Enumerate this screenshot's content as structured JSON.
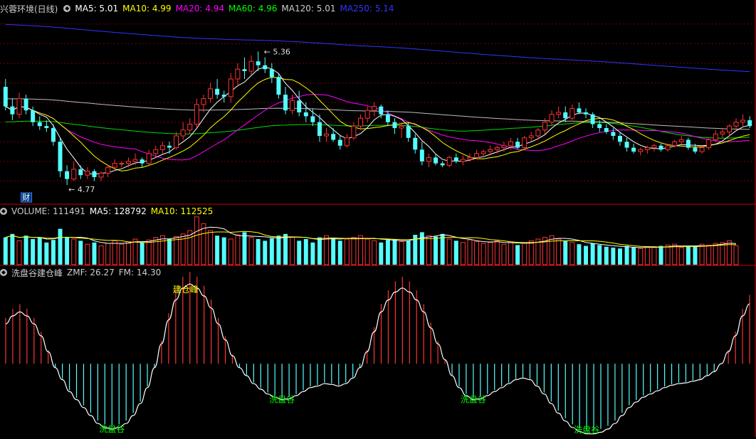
{
  "header": {
    "title": "兴蓉环境(日线)",
    "ma": [
      {
        "label": "MA5: 5.01",
        "color": "#ffffff"
      },
      {
        "label": "MA10: 4.99",
        "color": "#ffff00"
      },
      {
        "label": "MA20: 4.94",
        "color": "#ff00ff"
      },
      {
        "label": "MA60: 4.96",
        "color": "#00ff00"
      },
      {
        "label": "MA120: 5.01",
        "color": "#cccccc"
      },
      {
        "label": "MA250: 5.14",
        "color": "#3333ff"
      }
    ]
  },
  "volume_header": {
    "label": "VOLUME: 111491",
    "ma5": "MA5: 128792",
    "ma10": "MA10: 112525"
  },
  "indicator_header": {
    "name": "洗盘谷建仓峰",
    "zmf": "ZMF: 26.27",
    "fm": "FM: 14.30"
  },
  "colors": {
    "up": "#ff3333",
    "down": "#54ffff",
    "frame": "#cc0000",
    "bg": "#000000"
  },
  "chart_data": [
    {
      "type": "candlestick",
      "title": "兴蓉环境(日线)",
      "ylim": [
        4.6,
        5.55
      ],
      "annotations": [
        {
          "text": "5.36",
          "kind": "high"
        },
        {
          "text": "4.77",
          "kind": "low"
        },
        {
          "text": "财",
          "kind": "event"
        }
      ],
      "ohlc": [
        [
          5.18,
          5.22,
          5.06,
          5.08
        ],
        [
          5.08,
          5.12,
          5.01,
          5.04
        ],
        [
          5.04,
          5.15,
          5.02,
          5.12
        ],
        [
          5.12,
          5.14,
          5.04,
          5.06
        ],
        [
          5.06,
          5.08,
          4.98,
          5.0
        ],
        [
          5.0,
          5.03,
          4.96,
          4.98
        ],
        [
          4.98,
          5.01,
          4.95,
          4.97
        ],
        [
          4.97,
          4.99,
          4.88,
          4.9
        ],
        [
          4.9,
          4.92,
          4.72,
          4.75
        ],
        [
          4.75,
          4.78,
          4.68,
          4.71
        ],
        [
          4.71,
          4.8,
          4.7,
          4.76
        ],
        [
          4.76,
          4.78,
          4.71,
          4.73
        ],
        [
          4.73,
          4.77,
          4.71,
          4.75
        ],
        [
          4.75,
          4.76,
          4.7,
          4.72
        ],
        [
          4.72,
          4.75,
          4.7,
          4.74
        ],
        [
          4.74,
          4.78,
          4.72,
          4.77
        ],
        [
          4.77,
          4.81,
          4.75,
          4.79
        ],
        [
          4.79,
          4.8,
          4.77,
          4.79
        ],
        [
          4.79,
          4.82,
          4.77,
          4.8
        ],
        [
          4.8,
          4.84,
          4.78,
          4.81
        ],
        [
          4.81,
          4.82,
          4.77,
          4.79
        ],
        [
          4.79,
          4.86,
          4.78,
          4.84
        ],
        [
          4.84,
          4.88,
          4.82,
          4.86
        ],
        [
          4.86,
          4.9,
          4.84,
          4.88
        ],
        [
          4.88,
          4.9,
          4.84,
          4.87
        ],
        [
          4.87,
          4.95,
          4.86,
          4.93
        ],
        [
          4.93,
          5.0,
          4.91,
          4.96
        ],
        [
          4.96,
          5.02,
          4.94,
          4.99
        ],
        [
          4.99,
          5.12,
          4.97,
          5.09
        ],
        [
          5.09,
          5.14,
          5.05,
          5.12
        ],
        [
          5.12,
          5.2,
          5.1,
          5.17
        ],
        [
          5.17,
          5.22,
          5.12,
          5.14
        ],
        [
          5.14,
          5.16,
          5.1,
          5.13
        ],
        [
          5.13,
          5.25,
          5.1,
          5.22
        ],
        [
          5.22,
          5.3,
          5.18,
          5.27
        ],
        [
          5.27,
          5.33,
          5.22,
          5.26
        ],
        [
          5.26,
          5.34,
          5.24,
          5.31
        ],
        [
          5.31,
          5.36,
          5.26,
          5.29
        ],
        [
          5.29,
          5.33,
          5.25,
          5.27
        ],
        [
          5.27,
          5.3,
          5.2,
          5.23
        ],
        [
          5.23,
          5.25,
          5.12,
          5.14
        ],
        [
          5.14,
          5.18,
          5.04,
          5.06
        ],
        [
          5.06,
          5.14,
          5.04,
          5.11
        ],
        [
          5.11,
          5.16,
          5.03,
          5.05
        ],
        [
          5.05,
          5.1,
          5.0,
          5.03
        ],
        [
          5.03,
          5.07,
          4.98,
          5.0
        ],
        [
          5.0,
          5.04,
          4.9,
          4.93
        ],
        [
          4.93,
          4.97,
          4.9,
          4.94
        ],
        [
          4.94,
          4.97,
          4.9,
          4.91
        ],
        [
          4.91,
          4.93,
          4.86,
          4.88
        ],
        [
          4.88,
          4.94,
          4.87,
          4.92
        ],
        [
          4.92,
          5.0,
          4.91,
          4.98
        ],
        [
          4.98,
          5.04,
          4.96,
          5.02
        ],
        [
          5.02,
          5.08,
          5.0,
          5.06
        ],
        [
          5.06,
          5.1,
          5.03,
          5.08
        ],
        [
          5.08,
          5.09,
          5.02,
          5.04
        ],
        [
          5.04,
          5.06,
          4.98,
          5.0
        ],
        [
          5.0,
          5.02,
          4.94,
          4.97
        ],
        [
          4.97,
          5.0,
          4.92,
          4.98
        ],
        [
          4.98,
          5.0,
          4.9,
          4.92
        ],
        [
          4.92,
          4.94,
          4.84,
          4.86
        ],
        [
          4.86,
          4.9,
          4.78,
          4.8
        ],
        [
          4.8,
          4.84,
          4.77,
          4.82
        ],
        [
          4.82,
          4.84,
          4.78,
          4.79
        ],
        [
          4.79,
          4.8,
          4.77,
          4.78
        ],
        [
          4.78,
          4.83,
          4.77,
          4.82
        ],
        [
          4.82,
          4.84,
          4.79,
          4.8
        ],
        [
          4.8,
          4.83,
          4.78,
          4.81
        ],
        [
          4.81,
          4.84,
          4.8,
          4.82
        ],
        [
          4.82,
          4.86,
          4.81,
          4.84
        ],
        [
          4.84,
          4.86,
          4.82,
          4.85
        ],
        [
          4.85,
          4.88,
          4.83,
          4.86
        ],
        [
          4.86,
          4.88,
          4.84,
          4.87
        ],
        [
          4.87,
          4.9,
          4.85,
          4.88
        ],
        [
          4.88,
          4.92,
          4.86,
          4.9
        ],
        [
          4.9,
          4.92,
          4.86,
          4.87
        ],
        [
          4.87,
          4.93,
          4.86,
          4.92
        ],
        [
          4.92,
          4.95,
          4.9,
          4.93
        ],
        [
          4.93,
          4.97,
          4.91,
          4.96
        ],
        [
          4.96,
          5.02,
          4.94,
          5.0
        ],
        [
          5.0,
          5.06,
          4.98,
          5.04
        ],
        [
          5.04,
          5.08,
          5.02,
          5.05
        ],
        [
          5.05,
          5.08,
          5.0,
          5.02
        ],
        [
          5.02,
          5.09,
          5.01,
          5.07
        ],
        [
          5.07,
          5.1,
          5.04,
          5.05
        ],
        [
          5.05,
          5.07,
          5.02,
          5.04
        ],
        [
          5.04,
          5.05,
          4.97,
          4.99
        ],
        [
          4.99,
          5.01,
          4.95,
          4.97
        ],
        [
          4.97,
          4.99,
          4.94,
          4.95
        ],
        [
          4.95,
          4.97,
          4.91,
          4.93
        ],
        [
          4.93,
          4.95,
          4.88,
          4.9
        ],
        [
          4.9,
          4.92,
          4.85,
          4.87
        ],
        [
          4.87,
          4.89,
          4.84,
          4.85
        ],
        [
          4.85,
          4.87,
          4.83,
          4.86
        ],
        [
          4.86,
          4.88,
          4.84,
          4.87
        ],
        [
          4.87,
          4.89,
          4.85,
          4.88
        ],
        [
          4.88,
          4.89,
          4.85,
          4.86
        ],
        [
          4.86,
          4.89,
          4.85,
          4.88
        ],
        [
          4.88,
          4.91,
          4.87,
          4.9
        ],
        [
          4.9,
          4.93,
          4.89,
          4.91
        ],
        [
          4.91,
          4.92,
          4.86,
          4.87
        ],
        [
          4.87,
          4.89,
          4.84,
          4.85
        ],
        [
          4.85,
          4.88,
          4.84,
          4.87
        ],
        [
          4.87,
          4.92,
          4.86,
          4.91
        ],
        [
          4.91,
          4.96,
          4.9,
          4.94
        ],
        [
          4.94,
          4.97,
          4.92,
          4.95
        ],
        [
          4.95,
          4.99,
          4.93,
          4.98
        ],
        [
          4.98,
          5.02,
          4.96,
          5.0
        ],
        [
          5.0,
          5.04,
          4.98,
          5.01
        ],
        [
          5.01,
          5.03,
          4.97,
          4.98
        ]
      ]
    },
    {
      "type": "bar",
      "title": "VOLUME",
      "ylim": [
        0,
        300000
      ],
      "values": [
        160000,
        180000,
        140000,
        170000,
        150000,
        160000,
        130000,
        145000,
        210000,
        160000,
        150000,
        140000,
        120000,
        130000,
        110000,
        125000,
        140000,
        120000,
        135000,
        150000,
        130000,
        145000,
        160000,
        170000,
        150000,
        165000,
        180000,
        200000,
        280000,
        240000,
        200000,
        170000,
        160000,
        150000,
        175000,
        190000,
        160000,
        150000,
        140000,
        155000,
        170000,
        180000,
        160000,
        140000,
        150000,
        130000,
        160000,
        170000,
        150000,
        140000,
        150000,
        160000,
        170000,
        150000,
        140000,
        130000,
        145000,
        150000,
        135000,
        140000,
        175000,
        190000,
        170000,
        165000,
        180000,
        150000,
        140000,
        130000,
        145000,
        135000,
        125000,
        130000,
        140000,
        120000,
        130000,
        115000,
        125000,
        140000,
        150000,
        160000,
        170000,
        150000,
        140000,
        130000,
        120000,
        110000,
        125000,
        115000,
        105000,
        100000,
        95000,
        110000,
        100000,
        95000,
        105000,
        100000,
        110000,
        115000,
        120000,
        100000,
        105000,
        110000,
        120000,
        115000,
        125000,
        130000,
        140000,
        111491
      ],
      "series": [
        {
          "name": "MA5",
          "color": "#ffffff"
        },
        {
          "name": "MA10",
          "color": "#ffff00"
        }
      ]
    },
    {
      "type": "bar",
      "title": "洗盘谷建仓峰",
      "ylim": [
        -90,
        110
      ],
      "annotations": [
        {
          "text": "建仓峰"
        },
        {
          "text": "洗盘谷"
        },
        {
          "text": "洗盘谷"
        },
        {
          "text": "洗盘谷"
        },
        {
          "text": "洗盘谷"
        }
      ],
      "values": [
        50,
        60,
        65,
        60,
        50,
        35,
        15,
        -5,
        -20,
        -35,
        -45,
        -55,
        -65,
        -75,
        -80,
        -82,
        -80,
        -75,
        -65,
        -50,
        -30,
        -5,
        25,
        55,
        80,
        95,
        100,
        95,
        85,
        70,
        50,
        30,
        10,
        -5,
        -15,
        -25,
        -32,
        -38,
        -42,
        -45,
        -44,
        -40,
        -35,
        -30,
        -28,
        -25,
        -26,
        -28,
        -25,
        -18,
        -5,
        15,
        40,
        65,
        80,
        90,
        95,
        90,
        80,
        65,
        45,
        25,
        5,
        -15,
        -30,
        -40,
        -45,
        -44,
        -40,
        -35,
        -30,
        -25,
        -20,
        -18,
        -20,
        -28,
        -38,
        -50,
        -62,
        -72,
        -80,
        -85,
        -88,
        -88,
        -86,
        -82,
        -75,
        -65,
        -55,
        -48,
        -42,
        -38,
        -34,
        -30,
        -27,
        -25,
        -24,
        -22,
        -20,
        -15,
        -10,
        0,
        15,
        35,
        60,
        75
      ]
    }
  ]
}
